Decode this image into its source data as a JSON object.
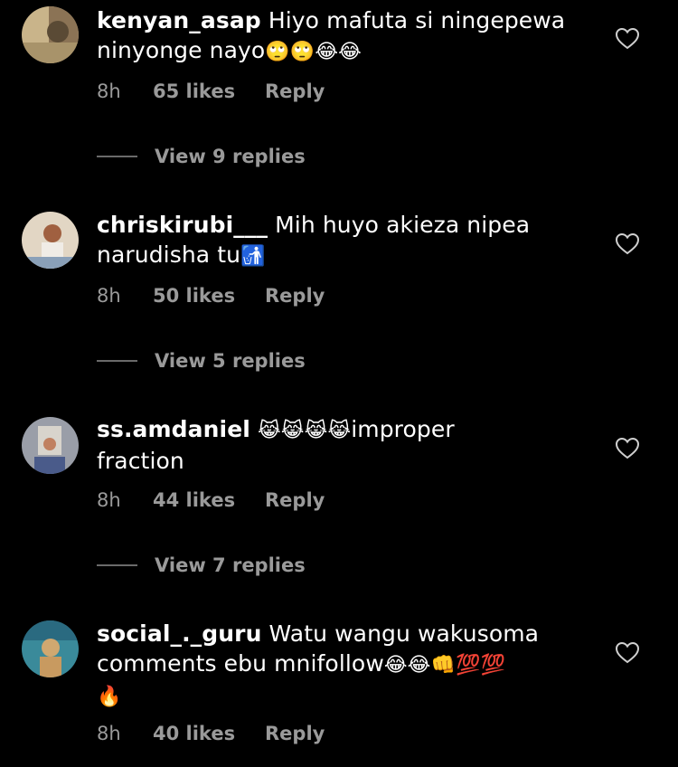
{
  "comments": [
    {
      "username": "kenyan_asap",
      "text": " Hiyo mafuta si ningepewa",
      "text2": "ninyonge nayo",
      "emojis": "🙄🙄😂😂",
      "time": "8h",
      "likes": "65 likes",
      "reply": "Reply",
      "view_replies": "View 9 replies",
      "avatar_colors": [
        "#c9b48a",
        "#5a4a35"
      ]
    },
    {
      "username": "chriskirubi___",
      "text": " Mih huyo akieza nipea",
      "text2": "narudisha tu",
      "emojis": "🚮",
      "time": "8h",
      "likes": "50 likes",
      "reply": "Reply",
      "view_replies": "View 5 replies",
      "avatar_colors": [
        "#d8c9b5",
        "#a06040"
      ]
    },
    {
      "username": "ss.amdaniel",
      "emojis_inline": "😹😹😹😹",
      "text": "improper",
      "text2": "fraction",
      "time": "8h",
      "likes": "44 likes",
      "reply": "Reply",
      "view_replies": "View 7 replies",
      "avatar_colors": [
        "#b8aeb0",
        "#4a5b8a"
      ]
    },
    {
      "username": "social_._guru",
      "text": " Watu wangu wakusoma",
      "text2": "comments ebu mnifollow",
      "emojis": "😂😂👊💯💯",
      "text3_emoji": "🔥",
      "time": "8h",
      "likes": "40 likes",
      "reply": "Reply",
      "avatar_colors": [
        "#3a8a9a",
        "#d0a870"
      ]
    }
  ],
  "icons": {
    "like": "heart-outline-icon"
  },
  "colors": {
    "background": "#000000",
    "secondary_text": "#9a9a9a"
  }
}
